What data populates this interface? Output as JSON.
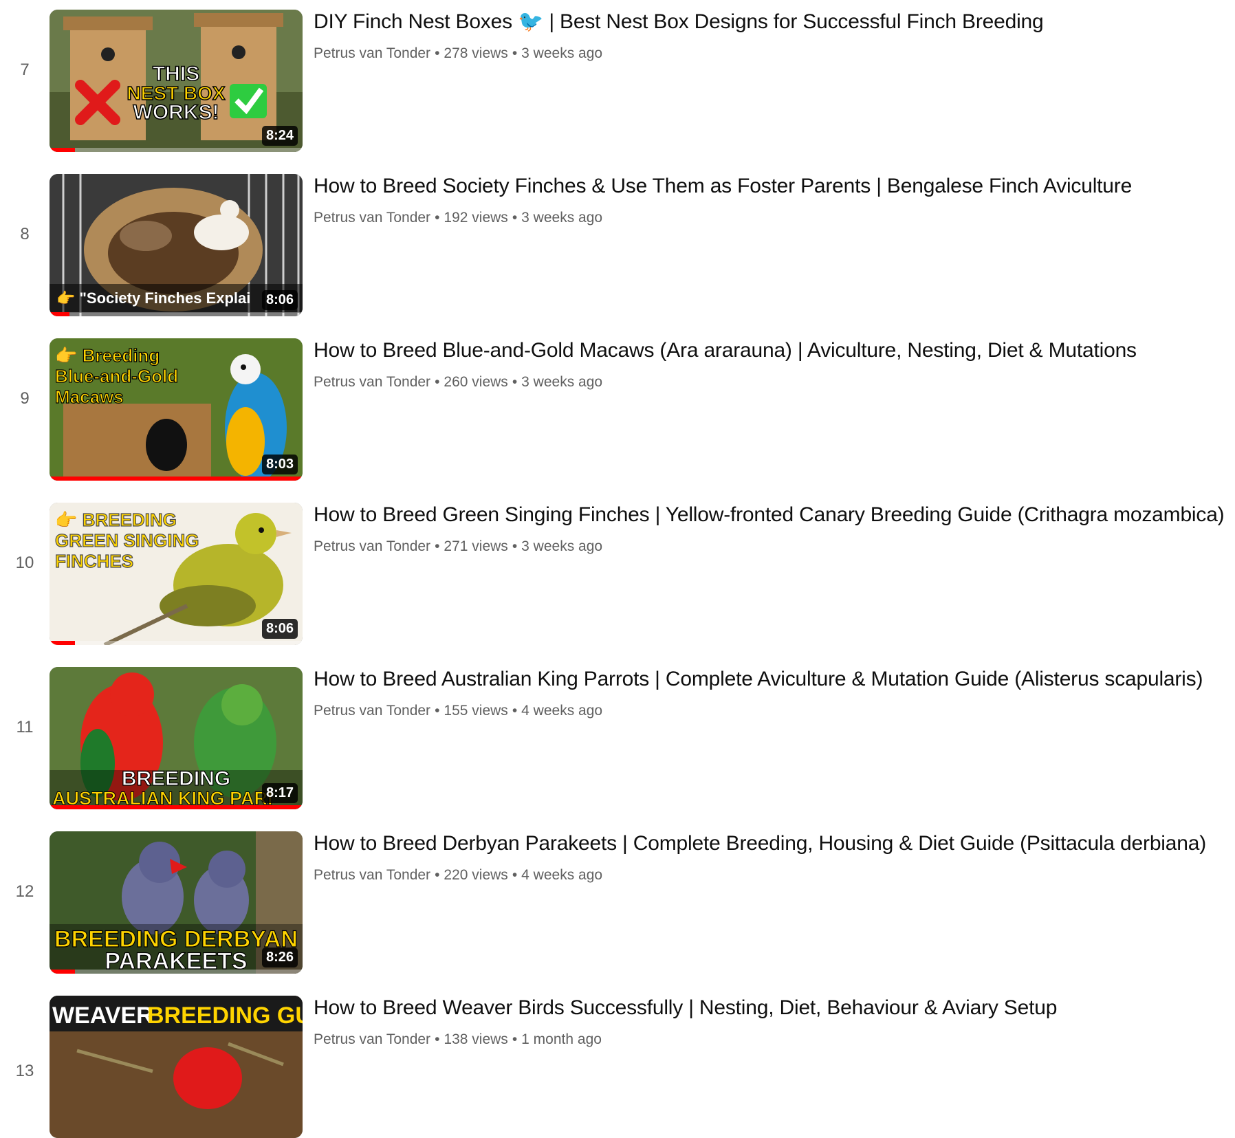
{
  "playlist": {
    "videos": [
      {
        "index": "7",
        "title": "DIY Finch Nest Boxes 🐦 | Best Nest Box Designs for Successful Finch Breeding",
        "channel": "Petrus van Tonder",
        "views": "278 views",
        "age": "3 weeks ago",
        "duration": "8:24",
        "watched_fraction": 0.1,
        "thumb_text": [
          "THIS",
          "NEST BOX",
          "WORKS!"
        ]
      },
      {
        "index": "8",
        "title": "How to Breed Society Finches & Use Them as Foster Parents | Bengalese Finch Aviculture",
        "channel": "Petrus van Tonder",
        "views": "192 views",
        "age": "3 weeks ago",
        "duration": "8:06",
        "watched_fraction": 0.08,
        "thumb_text": [
          "👉 \"Society Finches Explai"
        ]
      },
      {
        "index": "9",
        "title": "How to Breed Blue-and-Gold Macaws (Ara ararauna) | Aviculture, Nesting, Diet & Mutations",
        "channel": "Petrus van Tonder",
        "views": "260 views",
        "age": "3 weeks ago",
        "duration": "8:03",
        "watched_fraction": 1.0,
        "thumb_text": [
          "👉 Breeding",
          "Blue-and-Gold",
          "Macaws"
        ]
      },
      {
        "index": "10",
        "title": "How to Breed Green Singing Finches | Yellow-fronted Canary Breeding Guide (Crithagra mozambica)",
        "channel": "Petrus van Tonder",
        "views": "271 views",
        "age": "3 weeks ago",
        "duration": "8:06",
        "watched_fraction": 0.1,
        "thumb_text": [
          "👉 BREEDING",
          "GREEN SINGING",
          "FINCHES"
        ]
      },
      {
        "index": "11",
        "title": "How to Breed Australian King Parrots | Complete Aviculture & Mutation Guide (Alisterus scapularis)",
        "channel": "Petrus van Tonder",
        "views": "155 views",
        "age": "4 weeks ago",
        "duration": "8:17",
        "watched_fraction": 1.0,
        "thumb_text": [
          "BREEDING",
          "AUSTRALIAN KING PARI"
        ]
      },
      {
        "index": "12",
        "title": "How to Breed Derbyan Parakeets | Complete Breeding, Housing & Diet Guide (Psittacula derbiana)",
        "channel": "Petrus van Tonder",
        "views": "220 views",
        "age": "4 weeks ago",
        "duration": "8:26",
        "watched_fraction": 0.1,
        "thumb_text": [
          "BREEDING DERBYAN",
          "PARAKEETS"
        ]
      },
      {
        "index": "13",
        "title": "How to Breed Weaver Birds Successfully | Nesting, Diet, Behaviour & Aviary Setup",
        "channel": "Petrus van Tonder",
        "views": "138 views",
        "age": "1 month ago",
        "duration": "",
        "watched_fraction": 0,
        "thumb_text": [
          "WEAVER",
          "BREEDING GUIDE"
        ]
      }
    ],
    "meta_separator": "•"
  },
  "colors": {
    "title_text": "#0f0f0f",
    "meta_text": "#606060",
    "progress": "#ff0000",
    "thumb_yellow": "#ffd400",
    "thumb_green": "#2ecc40"
  }
}
